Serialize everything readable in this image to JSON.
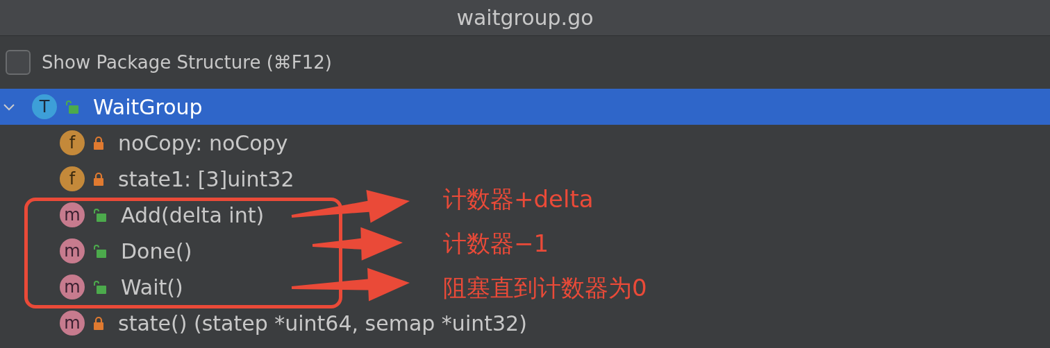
{
  "window": {
    "title": "waitgroup.go"
  },
  "show_package_structure": {
    "label": "Show Package Structure (⌘F12)",
    "checked": false
  },
  "tree": [
    {
      "name": "WaitGroup",
      "badge": "T",
      "kind": "type",
      "locked": false,
      "selected": true,
      "expanded": true,
      "children": [
        {
          "name": "noCopy: noCopy",
          "badge": "f",
          "kind": "field",
          "locked": true,
          "selected": false
        },
        {
          "name": "state1: [3]uint32",
          "badge": "f",
          "kind": "field",
          "locked": true,
          "selected": false
        },
        {
          "name": "Add(delta int)",
          "badge": "m",
          "kind": "method",
          "locked": false,
          "selected": false
        },
        {
          "name": "Done()",
          "badge": "m",
          "kind": "method",
          "locked": false,
          "selected": false
        },
        {
          "name": "Wait()",
          "badge": "m",
          "kind": "method",
          "locked": false,
          "selected": false
        },
        {
          "name": "state() (statep *uint64, semap *uint32)",
          "badge": "m",
          "kind": "method",
          "locked": true,
          "selected": false
        }
      ]
    }
  ],
  "annotations": [
    {
      "text": "计数器+delta"
    },
    {
      "text": "计数器−1"
    },
    {
      "text": "阻塞直到计数器为0"
    }
  ]
}
